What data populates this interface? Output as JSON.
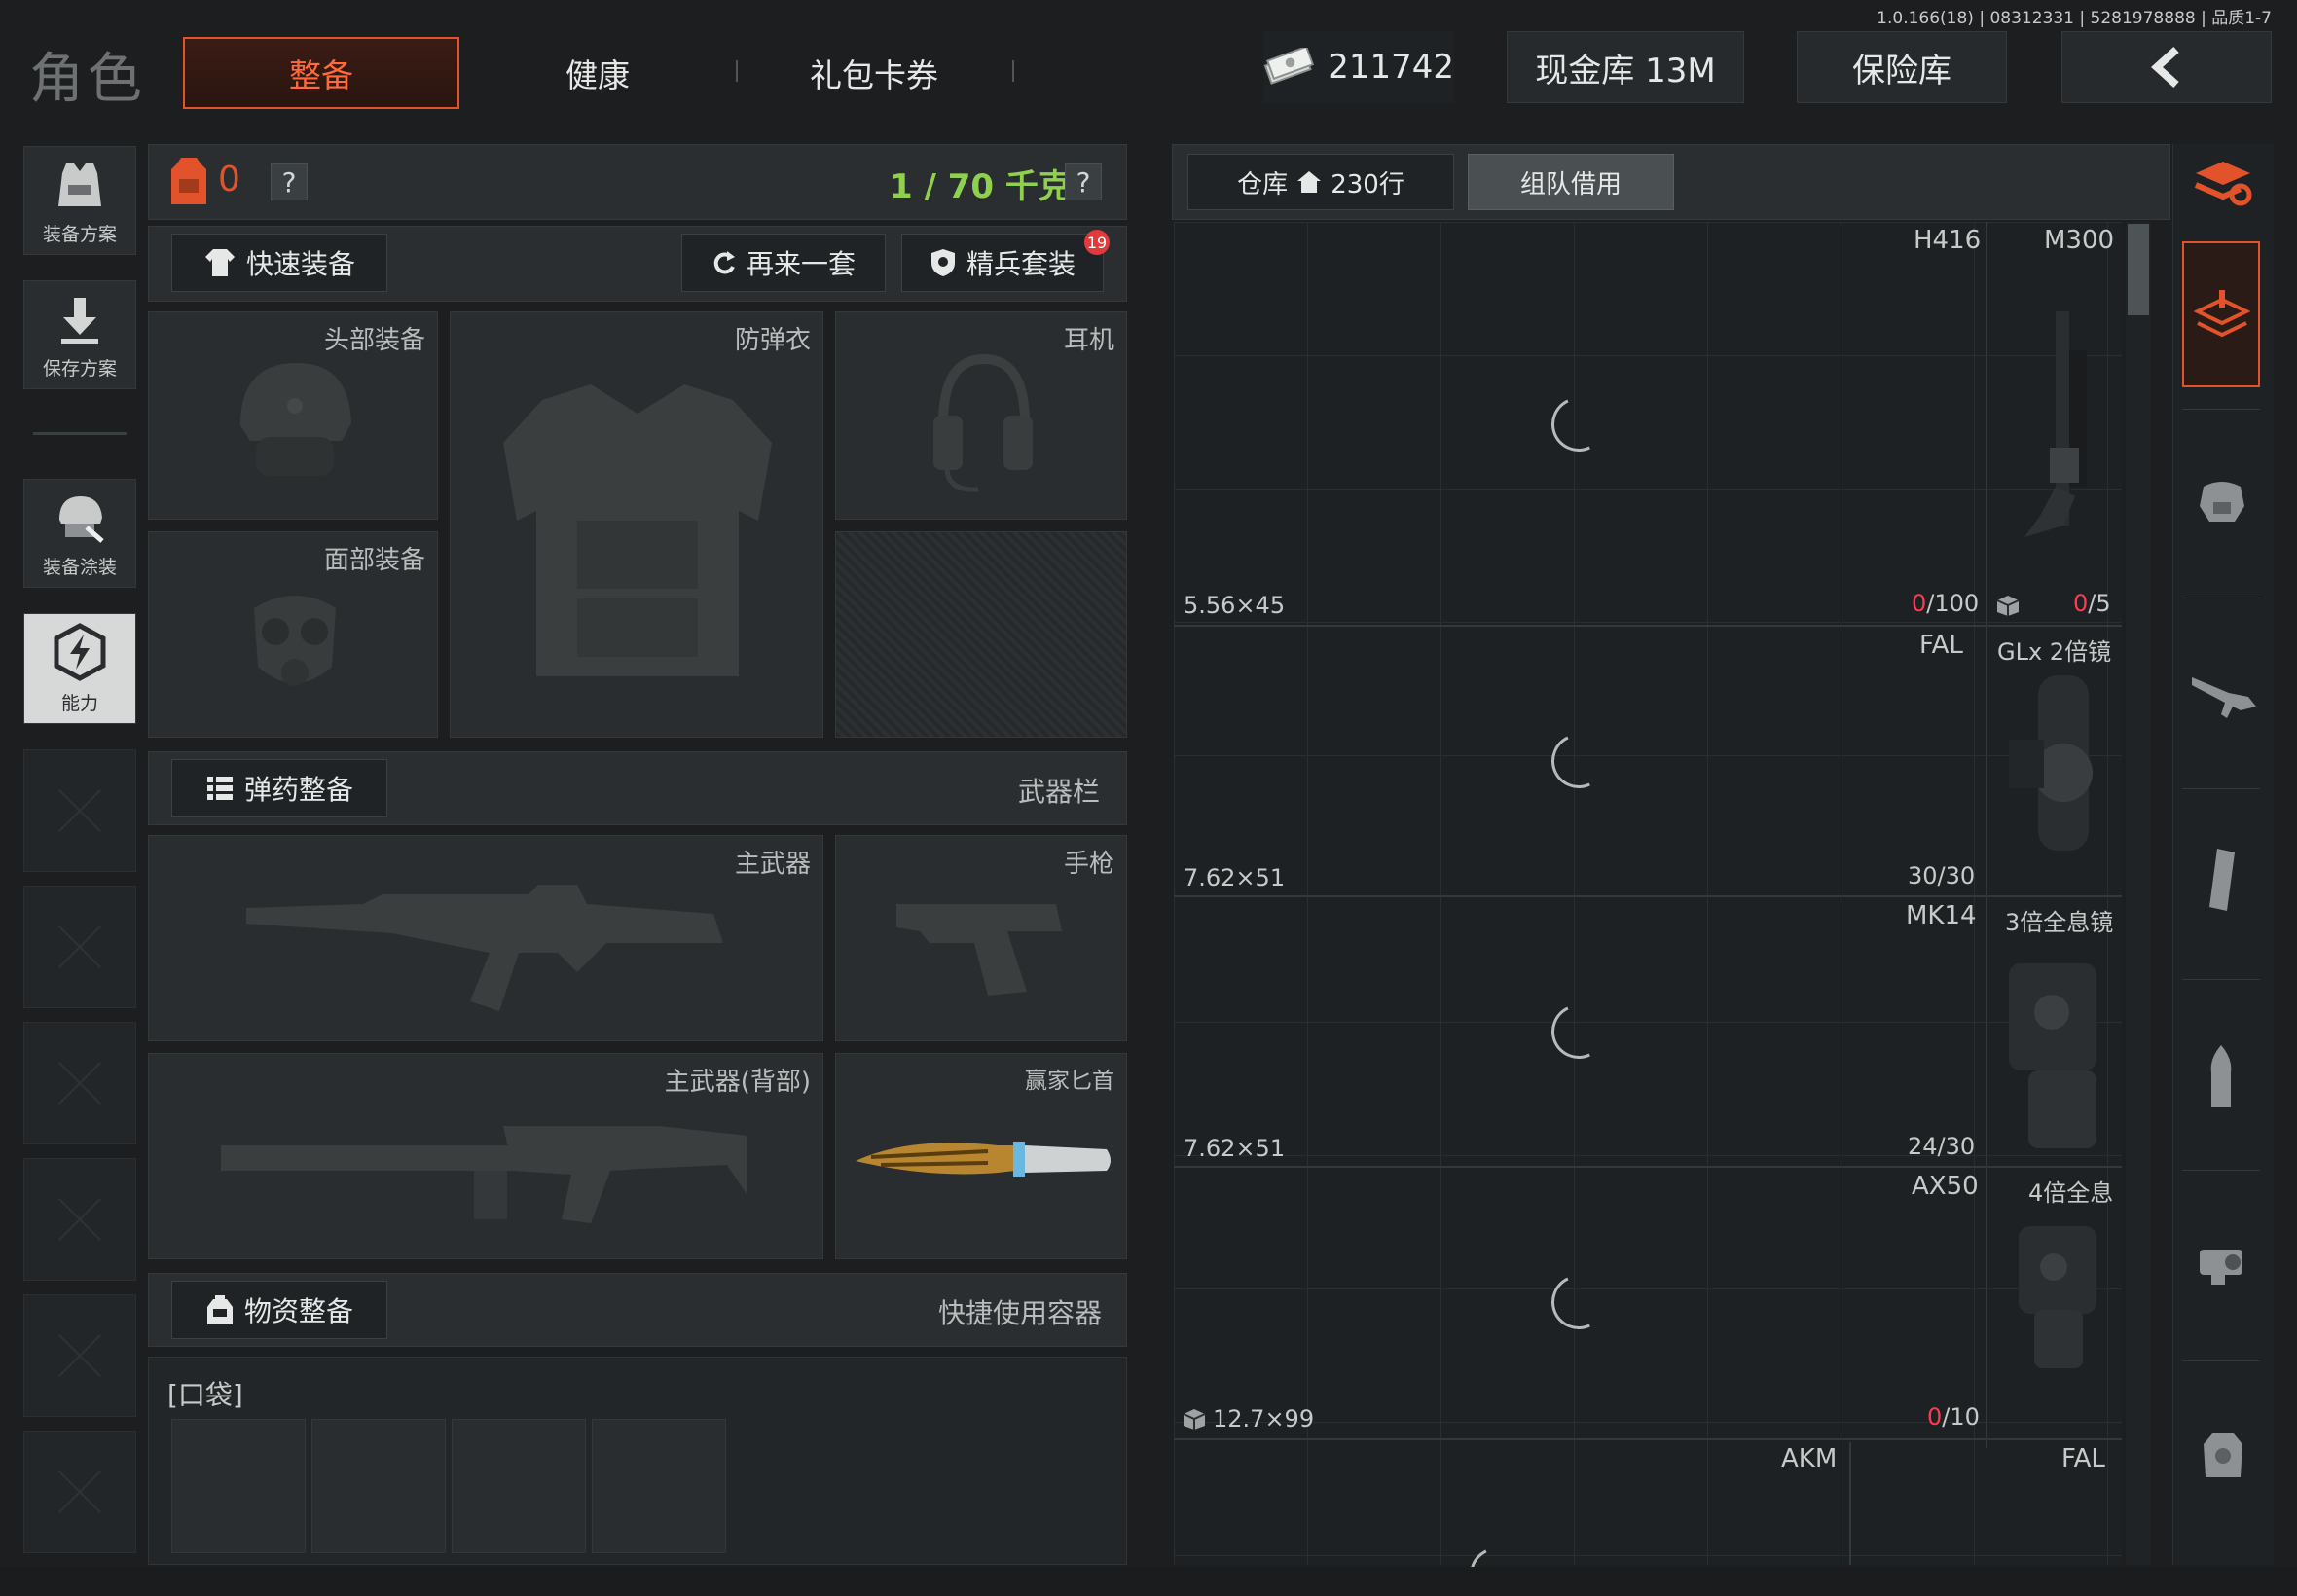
{
  "top_info": "1.0.166(18) | 08312331 | 5281978888 | 品质1-7",
  "header": {
    "title": "角色",
    "tabs": [
      {
        "label": "整备",
        "active": true
      },
      {
        "label": "健康",
        "active": false
      },
      {
        "label": "礼包卡券",
        "active": false
      }
    ],
    "currency": "211742",
    "cash_vault": "现金库 13M",
    "safe_box": "保险库"
  },
  "sidebar": {
    "items": [
      {
        "label": "装备方案",
        "icon": "vest-icon"
      },
      {
        "label": "保存方案",
        "icon": "download-icon"
      },
      {
        "label": "装备涂装",
        "icon": "helmet-paint-icon"
      },
      {
        "label": "能力",
        "icon": "ability-icon"
      }
    ]
  },
  "loadout": {
    "backpack_count": "0",
    "weight": "1 / 70 千克",
    "question": "?",
    "quick_equip": "快速装备",
    "another_set": "再来一套",
    "elite_set": "精兵套装",
    "elite_badge": "19",
    "slots": {
      "head": "头部装备",
      "armor": "防弹衣",
      "headset": "耳机",
      "face": "面部装备"
    },
    "ammo_section": "弹药整备",
    "weapon_bar": "武器栏",
    "weapon_slots": {
      "primary": "主武器",
      "pistol": "手枪",
      "primary_back": "主武器(背部)",
      "melee": "赢家匕首"
    },
    "supply_section": "物资整备",
    "quick_container": "快捷使用容器",
    "pocket": "[口袋]"
  },
  "warehouse": {
    "tab_storage": "仓库",
    "rows": "230行",
    "tab_team": "组队借用",
    "cells": [
      {
        "name": "H416",
        "caliber": "5.56×45",
        "count_red": "0",
        "count_rest": "/100",
        "side_name": "M300",
        "side_red": "0",
        "side_rest": "/5"
      },
      {
        "name": "FAL",
        "caliber": "7.62×51",
        "count_red": "",
        "count_rest": "30/30",
        "side_name": "GLx 2倍镜",
        "side_red": "",
        "side_rest": ""
      },
      {
        "name": "MK14",
        "caliber": "7.62×51",
        "count_red": "",
        "count_rest": "24/30",
        "side_name": "3倍全息镜",
        "side_red": "",
        "side_rest": ""
      },
      {
        "name": "AX50",
        "caliber": "12.7×99",
        "count_red": "0",
        "count_rest": "/10",
        "side_name": "4倍全息",
        "side_red": "",
        "side_rest": ""
      },
      {
        "name": "AKM",
        "caliber": "",
        "count_red": "",
        "count_rest": "",
        "side_name": "FAL",
        "side_red": "",
        "side_rest": ""
      }
    ]
  },
  "colors": {
    "accent": "#e2532b",
    "green": "#8fd14f",
    "red": "#ff3a4f"
  }
}
